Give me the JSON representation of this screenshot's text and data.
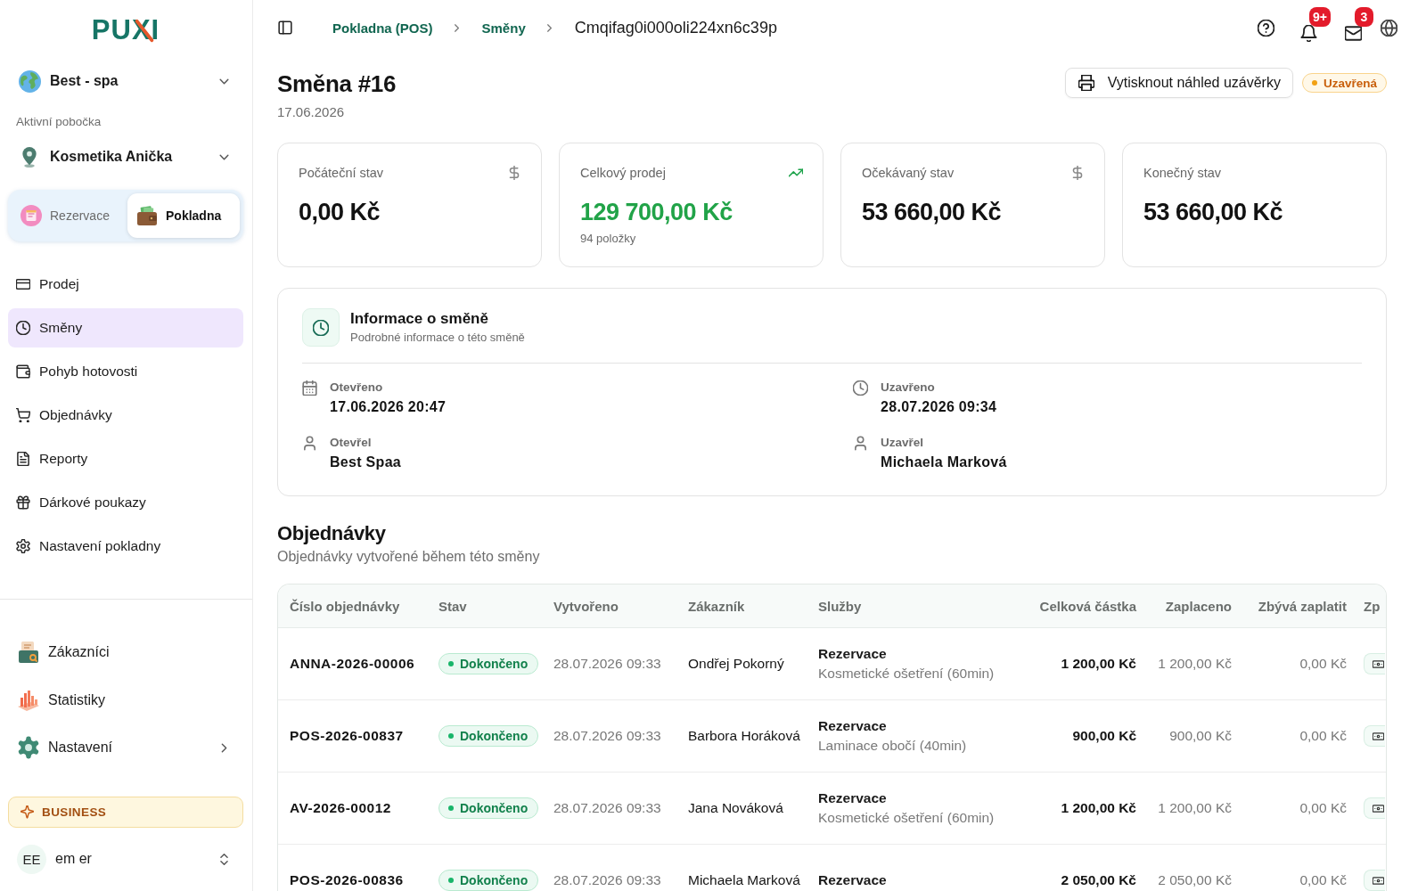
{
  "sidebar": {
    "logo": "PUXI",
    "workspace": "Best - spa",
    "branch_label": "Aktivní pobočka",
    "branch": "Kosmetika Anička",
    "modules": [
      {
        "label": "Rezervace",
        "selected": false
      },
      {
        "label": "Pokladna",
        "selected": true
      }
    ],
    "nav": [
      {
        "label": "Prodej",
        "selected": false
      },
      {
        "label": "Směny",
        "selected": true
      },
      {
        "label": "Pohyb hotovosti",
        "selected": false
      },
      {
        "label": "Objednávky",
        "selected": false
      },
      {
        "label": "Reporty",
        "selected": false
      },
      {
        "label": "Dárkové poukazy",
        "selected": false
      },
      {
        "label": "Nastavení pokladny",
        "selected": false
      }
    ],
    "apps": [
      {
        "label": "Zákazníci",
        "has_submenu": false
      },
      {
        "label": "Statistiky",
        "has_submenu": false
      },
      {
        "label": "Nastavení",
        "has_submenu": true
      }
    ],
    "plan": "BUSINESS",
    "user": {
      "initials": "EE",
      "name": "em er"
    }
  },
  "topbar": {
    "breadcrumbs": [
      {
        "label": "Pokladna (POS)",
        "kind": "link"
      },
      {
        "label": "Směny",
        "kind": "link"
      },
      {
        "label": "Cmqifag0i000oli224xn6c39p",
        "kind": "current"
      }
    ],
    "notifications_badge": "9+",
    "messages_badge": "3"
  },
  "shift": {
    "title": "Směna #16",
    "date": "17.06.2026",
    "print_button": "Vytisknout náhled uzávěrky",
    "status": "Uzavřená"
  },
  "stats": [
    {
      "label": "Počáteční stav",
      "value": "0,00 Kč",
      "highlighted": false
    },
    {
      "label": "Celkový prodej",
      "value": "129 700,00 Kč",
      "note": "94 položky",
      "highlighted": true
    },
    {
      "label": "Očekávaný stav",
      "value": "53 660,00 Kč",
      "highlighted": false
    },
    {
      "label": "Konečný stav",
      "value": "53 660,00 Kč",
      "highlighted": false
    }
  ],
  "info": {
    "title": "Informace o směně",
    "subtitle": "Podrobné informace o této směně",
    "fields": [
      {
        "label": "Otevřeno",
        "value": "17.06.2026 20:47"
      },
      {
        "label": "Uzavřeno",
        "value": "28.07.2026 09:34"
      },
      {
        "label": "Otevřel",
        "value": "Best Spaa"
      },
      {
        "label": "Uzavřel",
        "value": "Michaela Marková"
      }
    ]
  },
  "orders": {
    "title": "Objednávky",
    "subtitle": "Objednávky vytvořené během této směny",
    "columns": [
      "Číslo objednávky",
      "Stav",
      "Vytvořeno",
      "Zákazník",
      "Služby",
      "Celková částka",
      "Zaplaceno",
      "Zbývá zaplatit",
      "Zp"
    ],
    "rows": [
      {
        "number": "ANNA-2026-00006",
        "status": "Dokončeno",
        "created": "28.07.2026 09:33",
        "customer": "Ondřej Pokorný",
        "service_type": "Rezervace",
        "service_detail": "Kosmetické ošetření (60min)",
        "total": "1 200,00 Kč",
        "paid": "1 200,00 Kč",
        "remaining": "0,00 Kč"
      },
      {
        "number": "POS-2026-00837",
        "status": "Dokončeno",
        "created": "28.07.2026 09:33",
        "customer": "Barbora Horáková",
        "service_type": "Rezervace",
        "service_detail": "Laminace obočí (40min)",
        "total": "900,00 Kč",
        "paid": "900,00 Kč",
        "remaining": "0,00 Kč"
      },
      {
        "number": "AV-2026-00012",
        "status": "Dokončeno",
        "created": "28.07.2026 09:33",
        "customer": "Jana Nováková",
        "service_type": "Rezervace",
        "service_detail": "Kosmetické ošetření (60min)",
        "total": "1 200,00 Kč",
        "paid": "1 200,00 Kč",
        "remaining": "0,00 Kč"
      },
      {
        "number": "POS-2026-00836",
        "status": "Dokončeno",
        "created": "28.07.2026 09:33",
        "customer": "Michaela Marková",
        "service_type": "Rezervace",
        "total": "2 050,00 Kč",
        "paid": "2 050,00 Kč",
        "remaining": "0,00 Kč"
      }
    ]
  }
}
